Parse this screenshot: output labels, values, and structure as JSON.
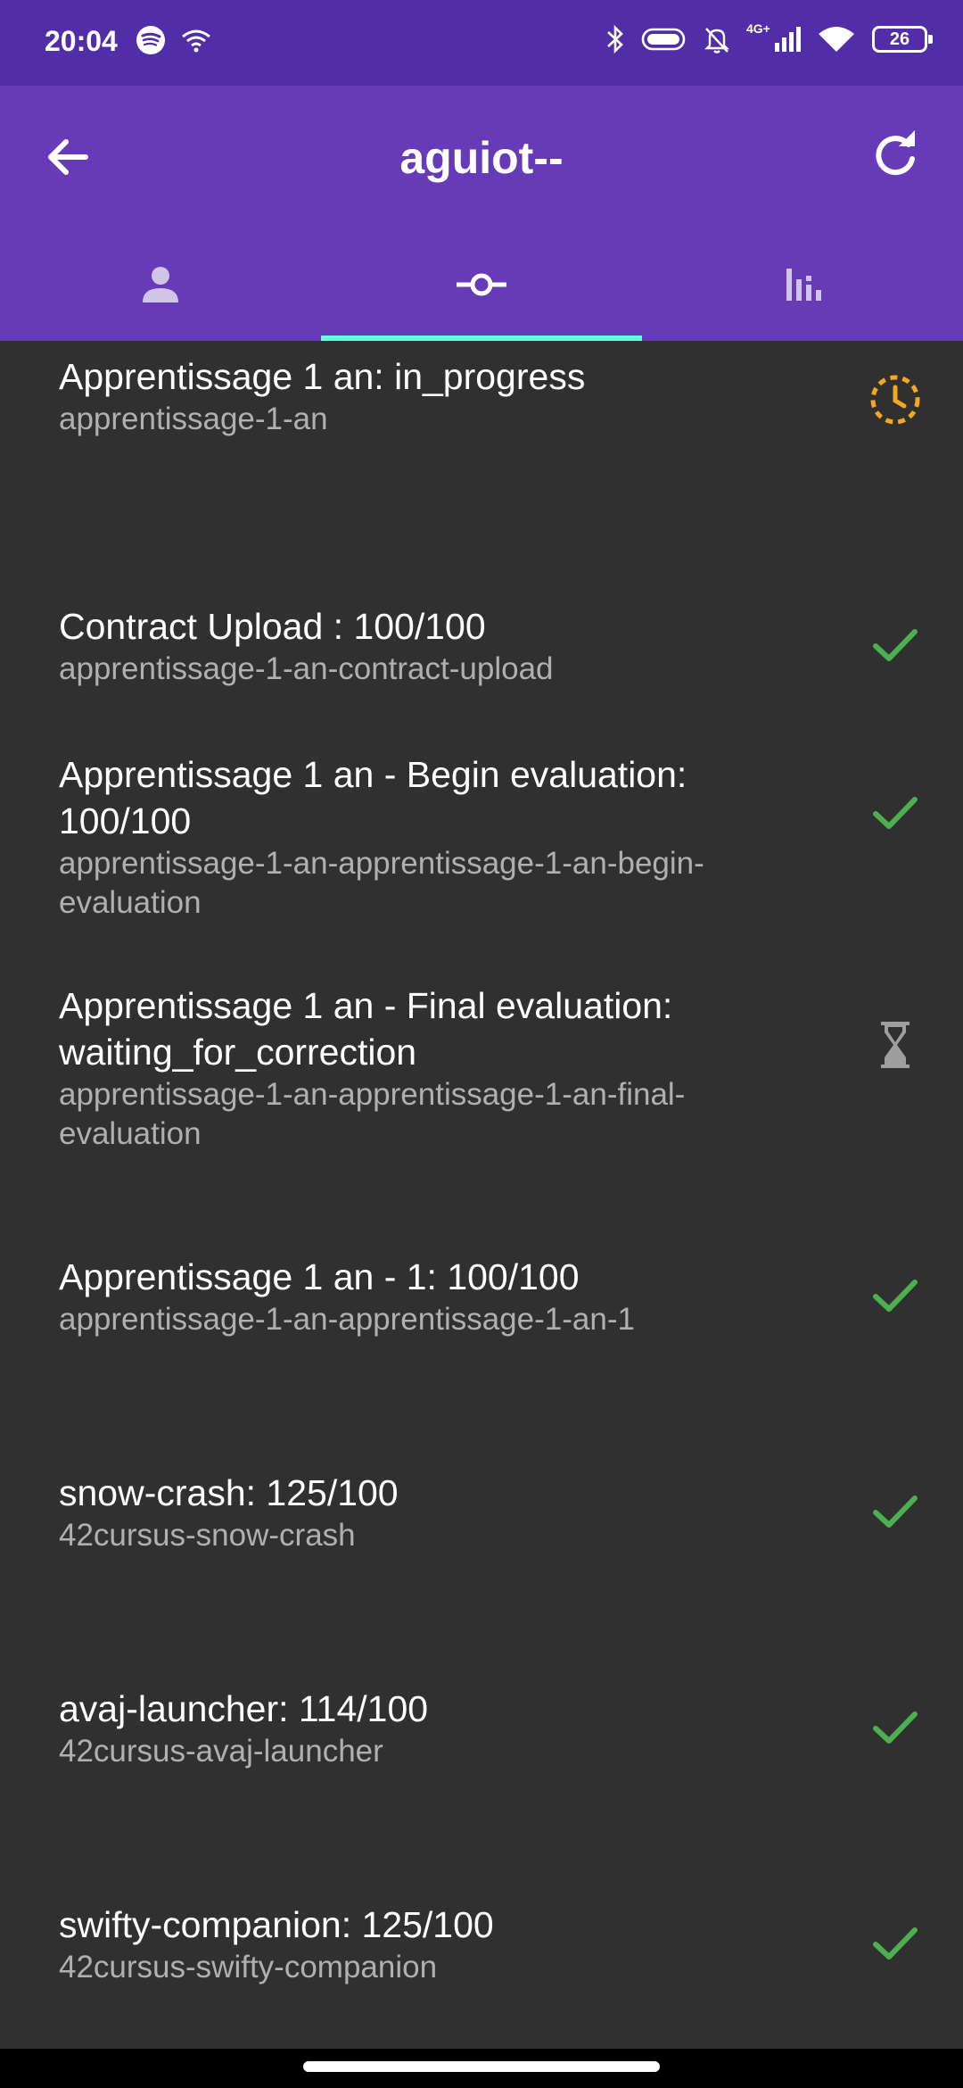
{
  "status_bar": {
    "time": "20:04",
    "network_label": "4G+",
    "battery": "26",
    "icons": [
      "spotify-icon",
      "wifi-icon",
      "bluetooth-icon",
      "toggle-icon",
      "bell-off-icon",
      "signal-icon",
      "wifi-icon",
      "battery-icon"
    ]
  },
  "appbar": {
    "title": "aguiot--",
    "back_icon": "arrow-back-icon",
    "refresh_icon": "refresh-icon"
  },
  "tabs": [
    {
      "name": "profile",
      "icon": "person-icon",
      "active": false
    },
    {
      "name": "projects",
      "icon": "commit-icon",
      "active": true
    },
    {
      "name": "stats",
      "icon": "bar-chart-icon",
      "active": false
    }
  ],
  "colors": {
    "statusbar": "#512da8",
    "appbar": "#673ab7",
    "tab_indicator": "#64ffda",
    "background": "#303030",
    "check": "#4caf50",
    "in_progress": "#f5a623",
    "waiting": "#9e9e9e"
  },
  "projects": [
    {
      "title": "Apprentissage 1 an: in_progress",
      "slug": "apprentissage-1-an",
      "status_icon": "clock-progress-icon"
    },
    {
      "title": "Contract Upload : 100/100",
      "slug": "apprentissage-1-an-contract-upload",
      "status_icon": "check-icon"
    },
    {
      "title": "Apprentissage 1 an - Begin evaluation: 100/100",
      "slug": "apprentissage-1-an-apprentissage-1-an-begin-evaluation",
      "status_icon": "check-icon"
    },
    {
      "title": "Apprentissage 1 an - Final evaluation: waiting_for_correction",
      "slug": "apprentissage-1-an-apprentissage-1-an-final-evaluation",
      "status_icon": "hourglass-icon"
    },
    {
      "title": "Apprentissage 1 an - 1: 100/100",
      "slug": "apprentissage-1-an-apprentissage-1-an-1",
      "status_icon": "check-icon"
    },
    {
      "title": "snow-crash: 125/100",
      "slug": "42cursus-snow-crash",
      "status_icon": "check-icon"
    },
    {
      "title": "avaj-launcher: 114/100",
      "slug": "42cursus-avaj-launcher",
      "status_icon": "check-icon"
    },
    {
      "title": "swifty-companion: 125/100",
      "slug": "42cursus-swifty-companion",
      "status_icon": "check-icon"
    }
  ]
}
